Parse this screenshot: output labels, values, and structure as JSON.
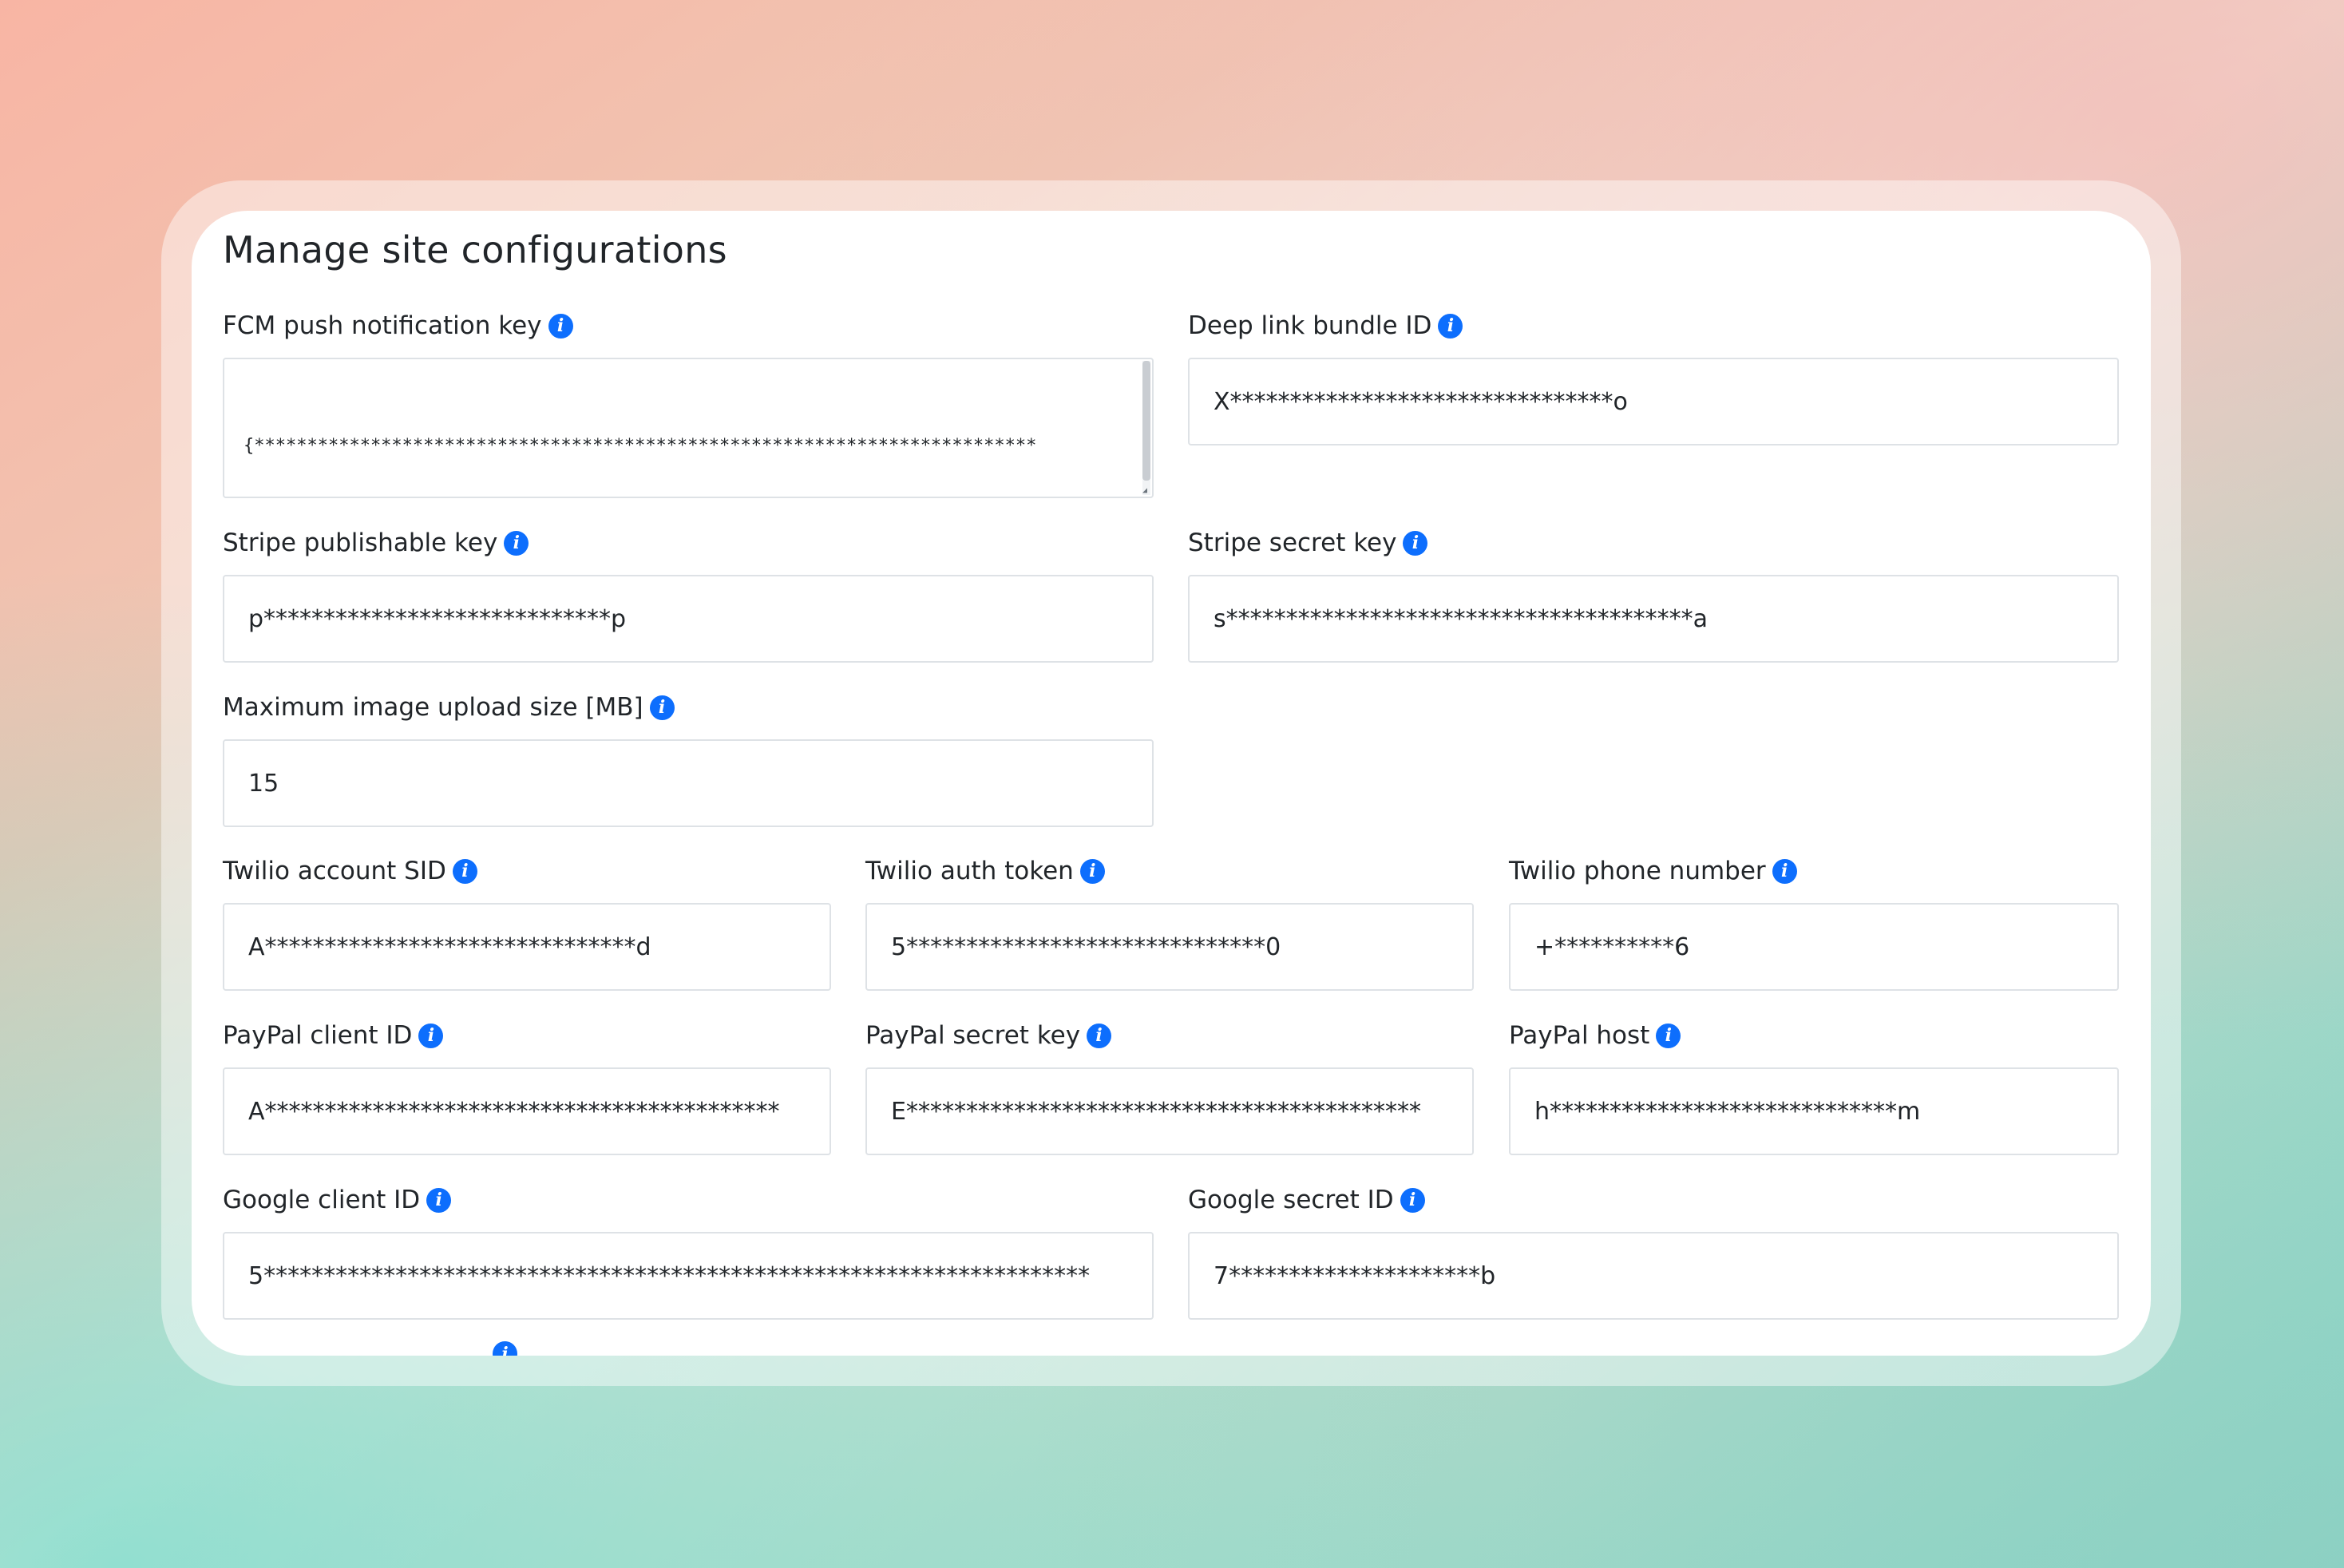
{
  "page": {
    "title": "Manage site configurations"
  },
  "fields": {
    "fcm_key": {
      "label": "FCM push notification key",
      "lines": [
        "{**************************************************************************",
        "***************************************************************************",
        "***************************************************************************",
        "***************************************************************************",
        "***************************************************************************"
      ]
    },
    "deep_link_bundle_id": {
      "label": "Deep link bundle ID",
      "value": "X********************************o"
    },
    "stripe_publishable_key": {
      "label": "Stripe publishable key",
      "value": "p*****************************p"
    },
    "stripe_secret_key": {
      "label": "Stripe secret key",
      "value": "s***************************************a"
    },
    "max_image_upload": {
      "label": "Maximum image upload size [MB]",
      "value": "15"
    },
    "twilio_account_sid": {
      "label": "Twilio account SID",
      "value": "A*******************************d"
    },
    "twilio_auth_token": {
      "label": "Twilio auth token",
      "value": "5******************************0"
    },
    "twilio_phone_number": {
      "label": "Twilio phone number",
      "value": "+**********6"
    },
    "paypal_client_id": {
      "label": "PayPal client ID",
      "value": "A*******************************************"
    },
    "paypal_secret_key": {
      "label": "PayPal secret key",
      "value": "E*******************************************"
    },
    "paypal_host": {
      "label": "PayPal host",
      "value": "h*****************************m"
    },
    "google_client_id": {
      "label": "Google client ID",
      "value": "5*********************************************************************"
    },
    "google_secret_id": {
      "label": "Google secret ID",
      "value": "7*********************b"
    }
  },
  "icons": {
    "info": "info-icon",
    "info_glyph": "i"
  },
  "colors": {
    "accent": "#0d6efd",
    "text": "#212529",
    "border": "#dee2e6"
  }
}
